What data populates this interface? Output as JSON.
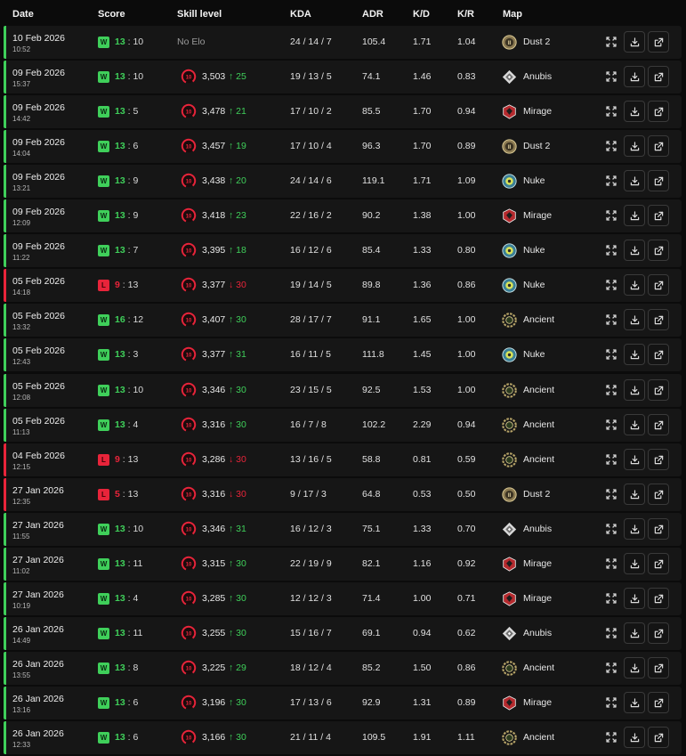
{
  "headers": {
    "date": "Date",
    "score": "Score",
    "skill": "Skill level",
    "kda": "KDA",
    "adr": "ADR",
    "kd": "K/D",
    "kr": "K/R",
    "map": "Map"
  },
  "colors": {
    "win": "#3fcf5a",
    "loss": "#e8243a",
    "level_ring": "#e8243a"
  },
  "matches": [
    {
      "date": "10 Feb 2026",
      "time": "10:52",
      "result": "W",
      "score_self": "13",
      "score_opp": "10",
      "level": null,
      "elo": "",
      "elo_text": "No Elo",
      "change": "",
      "change_dir": "",
      "kda": "24 / 14 / 7",
      "adr": "105.4",
      "kd": "1.71",
      "kr": "1.04",
      "map": "Dust 2"
    },
    {
      "date": "09 Feb 2026",
      "time": "15:37",
      "result": "W",
      "score_self": "13",
      "score_opp": "10",
      "level": "10",
      "elo": "3,503",
      "elo_text": "",
      "change": "25",
      "change_dir": "up",
      "kda": "19 / 13 / 5",
      "adr": "74.1",
      "kd": "1.46",
      "kr": "0.83",
      "map": "Anubis"
    },
    {
      "date": "09 Feb 2026",
      "time": "14:42",
      "result": "W",
      "score_self": "13",
      "score_opp": "5",
      "level": "10",
      "elo": "3,478",
      "elo_text": "",
      "change": "21",
      "change_dir": "up",
      "kda": "17 / 10 / 2",
      "adr": "85.5",
      "kd": "1.70",
      "kr": "0.94",
      "map": "Mirage"
    },
    {
      "date": "09 Feb 2026",
      "time": "14:04",
      "result": "W",
      "score_self": "13",
      "score_opp": "6",
      "level": "10",
      "elo": "3,457",
      "elo_text": "",
      "change": "19",
      "change_dir": "up",
      "kda": "17 / 10 / 4",
      "adr": "96.3",
      "kd": "1.70",
      "kr": "0.89",
      "map": "Dust 2"
    },
    {
      "date": "09 Feb 2026",
      "time": "13:21",
      "result": "W",
      "score_self": "13",
      "score_opp": "9",
      "level": "10",
      "elo": "3,438",
      "elo_text": "",
      "change": "20",
      "change_dir": "up",
      "kda": "24 / 14 / 6",
      "adr": "119.1",
      "kd": "1.71",
      "kr": "1.09",
      "map": "Nuke"
    },
    {
      "date": "09 Feb 2026",
      "time": "12:09",
      "result": "W",
      "score_self": "13",
      "score_opp": "9",
      "level": "10",
      "elo": "3,418",
      "elo_text": "",
      "change": "23",
      "change_dir": "up",
      "kda": "22 / 16 / 2",
      "adr": "90.2",
      "kd": "1.38",
      "kr": "1.00",
      "map": "Mirage"
    },
    {
      "date": "09 Feb 2026",
      "time": "11:22",
      "result": "W",
      "score_self": "13",
      "score_opp": "7",
      "level": "10",
      "elo": "3,395",
      "elo_text": "",
      "change": "18",
      "change_dir": "up",
      "kda": "16 / 12 / 6",
      "adr": "85.4",
      "kd": "1.33",
      "kr": "0.80",
      "map": "Nuke"
    },
    {
      "date": "05 Feb 2026",
      "time": "14:18",
      "result": "L",
      "score_self": "9",
      "score_opp": "13",
      "level": "10",
      "elo": "3,377",
      "elo_text": "",
      "change": "30",
      "change_dir": "down",
      "kda": "19 / 14 / 5",
      "adr": "89.8",
      "kd": "1.36",
      "kr": "0.86",
      "map": "Nuke"
    },
    {
      "date": "05 Feb 2026",
      "time": "13:32",
      "result": "W",
      "score_self": "16",
      "score_opp": "12",
      "level": "10",
      "elo": "3,407",
      "elo_text": "",
      "change": "30",
      "change_dir": "up",
      "kda": "28 / 17 / 7",
      "adr": "91.1",
      "kd": "1.65",
      "kr": "1.00",
      "map": "Ancient"
    },
    {
      "date": "05 Feb 2026",
      "time": "12:43",
      "result": "W",
      "score_self": "13",
      "score_opp": "3",
      "level": "10",
      "elo": "3,377",
      "elo_text": "",
      "change": "31",
      "change_dir": "up",
      "kda": "16 / 11 / 5",
      "adr": "111.8",
      "kd": "1.45",
      "kr": "1.00",
      "map": "Nuke"
    },
    {
      "date": "05 Feb 2026",
      "time": "12:08",
      "result": "W",
      "score_self": "13",
      "score_opp": "10",
      "level": "10",
      "elo": "3,346",
      "elo_text": "",
      "change": "30",
      "change_dir": "up",
      "kda": "23 / 15 / 5",
      "adr": "92.5",
      "kd": "1.53",
      "kr": "1.00",
      "map": "Ancient"
    },
    {
      "date": "05 Feb 2026",
      "time": "11:13",
      "result": "W",
      "score_self": "13",
      "score_opp": "4",
      "level": "10",
      "elo": "3,316",
      "elo_text": "",
      "change": "30",
      "change_dir": "up",
      "kda": "16 / 7 / 8",
      "adr": "102.2",
      "kd": "2.29",
      "kr": "0.94",
      "map": "Ancient"
    },
    {
      "date": "04 Feb 2026",
      "time": "12:15",
      "result": "L",
      "score_self": "9",
      "score_opp": "13",
      "level": "10",
      "elo": "3,286",
      "elo_text": "",
      "change": "30",
      "change_dir": "down",
      "kda": "13 / 16 / 5",
      "adr": "58.8",
      "kd": "0.81",
      "kr": "0.59",
      "map": "Ancient"
    },
    {
      "date": "27 Jan 2026",
      "time": "12:35",
      "result": "L",
      "score_self": "5",
      "score_opp": "13",
      "level": "10",
      "elo": "3,316",
      "elo_text": "",
      "change": "30",
      "change_dir": "down",
      "kda": "9 / 17 / 3",
      "adr": "64.8",
      "kd": "0.53",
      "kr": "0.50",
      "map": "Dust 2"
    },
    {
      "date": "27 Jan 2026",
      "time": "11:55",
      "result": "W",
      "score_self": "13",
      "score_opp": "10",
      "level": "10",
      "elo": "3,346",
      "elo_text": "",
      "change": "31",
      "change_dir": "up",
      "kda": "16 / 12 / 3",
      "adr": "75.1",
      "kd": "1.33",
      "kr": "0.70",
      "map": "Anubis"
    },
    {
      "date": "27 Jan 2026",
      "time": "11:02",
      "result": "W",
      "score_self": "13",
      "score_opp": "11",
      "level": "10",
      "elo": "3,315",
      "elo_text": "",
      "change": "30",
      "change_dir": "up",
      "kda": "22 / 19 / 9",
      "adr": "82.1",
      "kd": "1.16",
      "kr": "0.92",
      "map": "Mirage"
    },
    {
      "date": "27 Jan 2026",
      "time": "10:19",
      "result": "W",
      "score_self": "13",
      "score_opp": "4",
      "level": "10",
      "elo": "3,285",
      "elo_text": "",
      "change": "30",
      "change_dir": "up",
      "kda": "12 / 12 / 3",
      "adr": "71.4",
      "kd": "1.00",
      "kr": "0.71",
      "map": "Mirage"
    },
    {
      "date": "26 Jan 2026",
      "time": "14:49",
      "result": "W",
      "score_self": "13",
      "score_opp": "11",
      "level": "10",
      "elo": "3,255",
      "elo_text": "",
      "change": "30",
      "change_dir": "up",
      "kda": "15 / 16 / 7",
      "adr": "69.1",
      "kd": "0.94",
      "kr": "0.62",
      "map": "Anubis"
    },
    {
      "date": "26 Jan 2026",
      "time": "13:55",
      "result": "W",
      "score_self": "13",
      "score_opp": "8",
      "level": "10",
      "elo": "3,225",
      "elo_text": "",
      "change": "29",
      "change_dir": "up",
      "kda": "18 / 12 / 4",
      "adr": "85.2",
      "kd": "1.50",
      "kr": "0.86",
      "map": "Ancient"
    },
    {
      "date": "26 Jan 2026",
      "time": "13:16",
      "result": "W",
      "score_self": "13",
      "score_opp": "6",
      "level": "10",
      "elo": "3,196",
      "elo_text": "",
      "change": "30",
      "change_dir": "up",
      "kda": "17 / 13 / 6",
      "adr": "92.9",
      "kd": "1.31",
      "kr": "0.89",
      "map": "Mirage"
    },
    {
      "date": "26 Jan 2026",
      "time": "12:33",
      "result": "W",
      "score_self": "13",
      "score_opp": "6",
      "level": "10",
      "elo": "3,166",
      "elo_text": "",
      "change": "30",
      "change_dir": "up",
      "kda": "21 / 11 / 4",
      "adr": "109.5",
      "kd": "1.91",
      "kr": "1.11",
      "map": "Ancient"
    }
  ]
}
